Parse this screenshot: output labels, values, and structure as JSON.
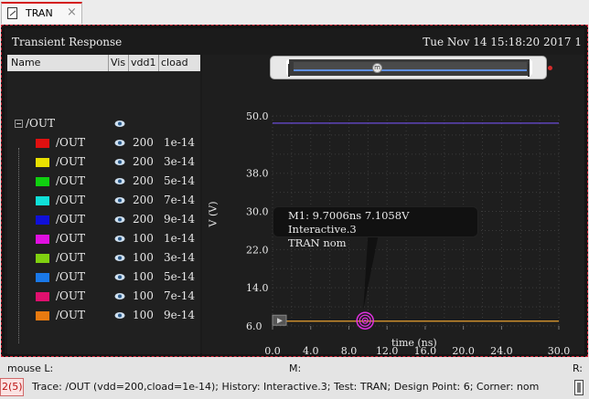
{
  "tab": {
    "label": "TRAN",
    "close": "×"
  },
  "header": {
    "title": "Transient Response",
    "datetime": "Tue Nov 14 15:18:20 2017  1"
  },
  "list": {
    "columns": [
      "Name",
      "Vis",
      "vdd1",
      "cload"
    ],
    "root": "/OUT",
    "rows": [
      {
        "name": "/OUT",
        "vdd1": "200",
        "cload": "1e-14",
        "color": "#e01010"
      },
      {
        "name": "/OUT",
        "vdd1": "200",
        "cload": "3e-14",
        "color": "#e8e000"
      },
      {
        "name": "/OUT",
        "vdd1": "200",
        "cload": "5e-14",
        "color": "#10d010"
      },
      {
        "name": "/OUT",
        "vdd1": "200",
        "cload": "7e-14",
        "color": "#10e0d8"
      },
      {
        "name": "/OUT",
        "vdd1": "200",
        "cload": "9e-14",
        "color": "#1010d8"
      },
      {
        "name": "/OUT",
        "vdd1": "100",
        "cload": "1e-14",
        "color": "#e010e0"
      },
      {
        "name": "/OUT",
        "vdd1": "100",
        "cload": "3e-14",
        "color": "#80d010"
      },
      {
        "name": "/OUT",
        "vdd1": "100",
        "cload": "5e-14",
        "color": "#1a78e8"
      },
      {
        "name": "/OUT",
        "vdd1": "100",
        "cload": "7e-14",
        "color": "#e0106e"
      },
      {
        "name": "/OUT",
        "vdd1": "100",
        "cload": "9e-14",
        "color": "#e87a10"
      }
    ]
  },
  "chart_data": {
    "type": "line",
    "xlabel": "time (ns)",
    "ylabel": "V (V)",
    "xlim": [
      0,
      30
    ],
    "ylim": [
      6,
      50
    ],
    "xticks": [
      "0.0",
      "4.0",
      "8.0",
      "12.0",
      "16.0",
      "20.0",
      "24.0",
      "30.0"
    ],
    "xtick_values": [
      0,
      4,
      8,
      12,
      16,
      20,
      24,
      30
    ],
    "yticks": [
      "50.0",
      "38.0",
      "30.0",
      "22.0",
      "14.0",
      "6.0"
    ],
    "ytick_values": [
      50,
      38,
      30,
      22,
      14,
      6
    ],
    "series": [
      {
        "color": "#6a4cd8",
        "y": 48.5
      },
      {
        "color": "#e8a030",
        "y": 7.0
      }
    ],
    "marker": {
      "x": 9.7006,
      "y": 7.1058,
      "color": "#e030e0"
    },
    "tooltip": {
      "line1": "M1: 9.7006ns 7.1058V Interactive.3",
      "line2": "TRAN nom"
    }
  },
  "status": {
    "mouse_l": "mouse L:",
    "m": "M:",
    "r": "R:",
    "left_badge": "2(5)",
    "trace": "Trace: /OUT (vdd=200,cload=1e-14); History: Interactive.3; Test: TRAN; Design Point: 6; Corner: nom"
  }
}
